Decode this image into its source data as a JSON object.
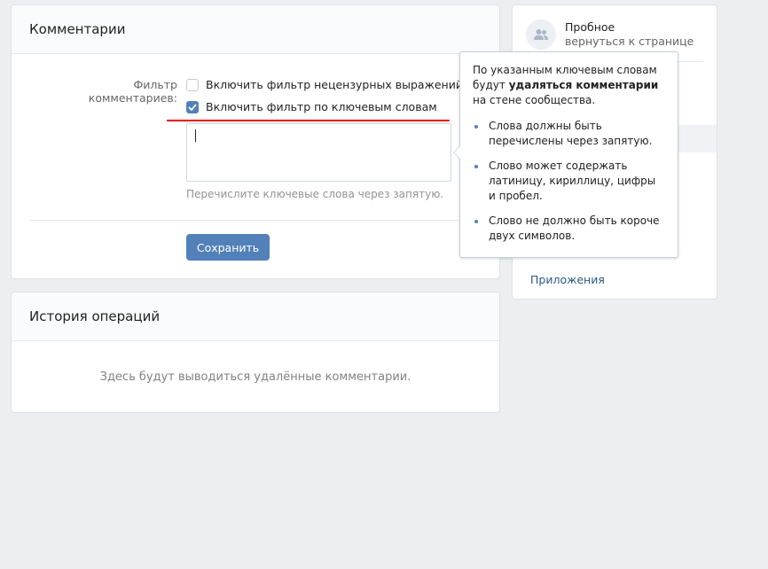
{
  "comments": {
    "title": "Комментарии",
    "filter_label": "Фильтр комментариев:",
    "checkbox_obscene": {
      "label": "Включить фильтр нецензурных выражений",
      "checked": false
    },
    "checkbox_keywords": {
      "label": "Включить фильтр по ключевым словам",
      "checked": true
    },
    "keywords_value": "",
    "hint": "Перечислите ключевые слова через запятую.",
    "save_label": "Сохранить"
  },
  "history": {
    "title": "История операций",
    "empty_text": "Здесь будут выводиться удалённые комментарии."
  },
  "sidebar": {
    "community_name": "Пробное",
    "back_link": "вернуться к странице",
    "apps_link": "Приложения"
  },
  "tooltip": {
    "intro_1": "По указанным ключевым словам",
    "intro_2": "будут ",
    "intro_bold": "удаляться комментарии",
    "intro_3": "на стене сообщества.",
    "bullets": [
      "Слова должны быть перечислены через запятую.",
      "Слово может содержать латиницу, кириллицу, цифры и пробел.",
      "Слово не должно быть короче двух символов."
    ]
  },
  "colors": {
    "accent": "#5181b8",
    "underline": "#e00000"
  }
}
